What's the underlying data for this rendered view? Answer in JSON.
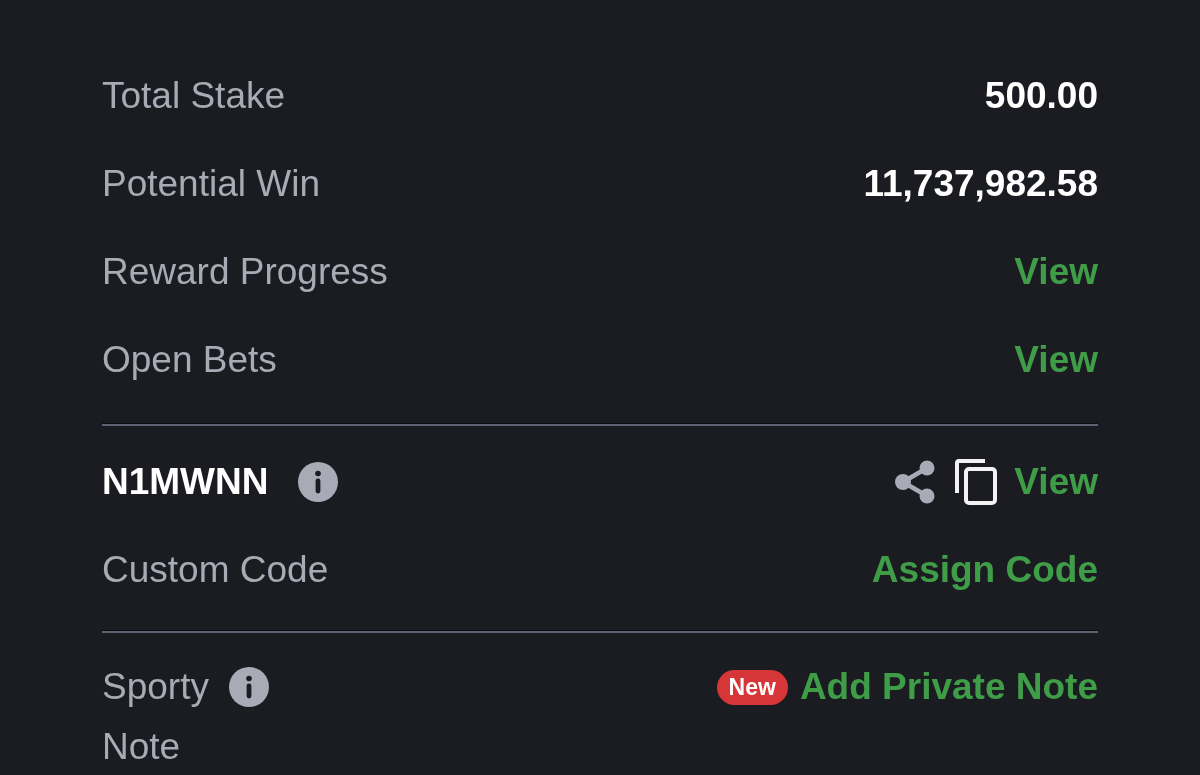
{
  "summary_rows": [
    {
      "label": "Total Stake",
      "value": "500.00",
      "kind": "amount"
    },
    {
      "label": "Potential Win",
      "value": "11,737,982.58",
      "kind": "amount"
    },
    {
      "label": "Reward Progress",
      "value": "View",
      "kind": "link"
    },
    {
      "label": "Open Bets",
      "value": "View",
      "kind": "link"
    }
  ],
  "booking": {
    "code": "N1MWNN",
    "link": "View",
    "custom_code": {
      "label": "Custom Code",
      "link": "Assign Code"
    }
  },
  "note": {
    "label": "Sporty Note",
    "badge": "New",
    "link": "Add Private Note"
  }
}
